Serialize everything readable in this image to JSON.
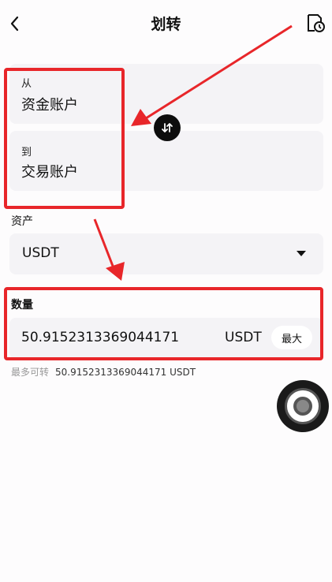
{
  "header": {
    "title": "划转",
    "back_icon": "chevron-left-icon",
    "history_icon": "document-clock-icon"
  },
  "transfer": {
    "from_label": "从",
    "from_account": "资金账户",
    "to_label": "到",
    "to_account": "交易账户",
    "swap_icon": "swap-arrows-icon"
  },
  "asset": {
    "label": "资产",
    "value": "USDT"
  },
  "amount": {
    "label": "数量",
    "value": "50.9152313369044171",
    "unit": "USDT",
    "max_label": "最大"
  },
  "available": {
    "label": "最多可转",
    "value": "50.9152313369044171 USDT"
  },
  "annotation": {
    "color": "#e8262a"
  }
}
